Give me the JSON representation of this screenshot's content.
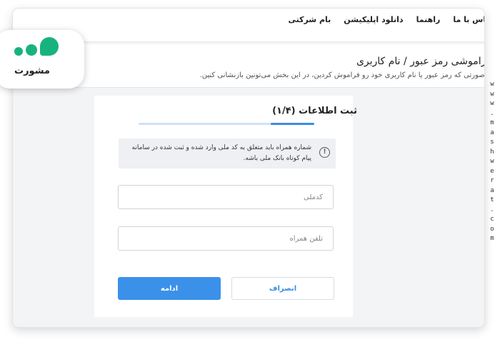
{
  "nav": {
    "items": [
      "تماس با ما",
      "راهنما",
      "دانلود اپلیکیشن",
      "بام شرکتی"
    ]
  },
  "header": {
    "title": "فراموشی رمز عبور / نام کاربری",
    "subtitle": "درصورتی که رمز عبور یا نام کاربری خود رو فراموش کردین، در این بخش می‌تونین بازنشانی کنین."
  },
  "form": {
    "title": "ثبت اطلاعات (۱/۴)",
    "step_progress": 0.25,
    "info_text": "شماره همراه باید متعلق به کد ملی وارد شده و ثبت شده در سامانه پیام کوتاه بانک ملی باشه.",
    "info_icon": "exclamation-circle-icon",
    "national_code_placeholder": "کدملی",
    "national_code_value": "",
    "mobile_placeholder": "تلفن همراه",
    "mobile_value": "",
    "continue_label": "ادامه",
    "cancel_label": "انصراف"
  },
  "logo": {
    "text": "مشورت",
    "accent_color": "#17b27f"
  },
  "watermark": "www.mashwerat.com",
  "colors": {
    "primary": "#3b91e9",
    "progress_track": "#cfe2f8",
    "info_bg": "#eef0f3"
  }
}
